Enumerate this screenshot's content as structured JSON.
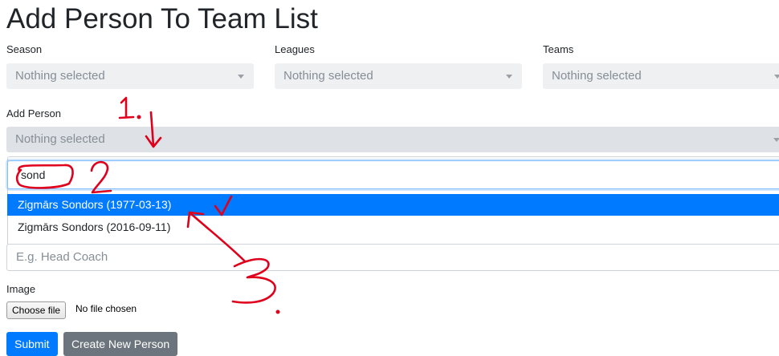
{
  "page": {
    "title": "Add Person To Team List"
  },
  "filters": [
    {
      "label": "Season",
      "placeholder": "Nothing selected"
    },
    {
      "label": "Leagues",
      "placeholder": "Nothing selected"
    },
    {
      "label": "Teams",
      "placeholder": "Nothing selected"
    }
  ],
  "add_person": {
    "label": "Add Person",
    "placeholder": "Nothing selected",
    "search_value": "sond",
    "options": [
      {
        "label": "Zigmārs Sondors (1977-03-13)",
        "active": true
      },
      {
        "label": "Zigmārs Sondors (2016-09-11)",
        "active": false
      }
    ]
  },
  "role_input": {
    "placeholder": "E.g. Head Coach"
  },
  "image": {
    "label": "Image",
    "choose_button": "Choose file",
    "status": "No file chosen"
  },
  "buttons": {
    "submit": "Submit",
    "create_person": "Create New Person"
  },
  "annotations": {
    "step1": "1.",
    "step2": "2",
    "step3": "3",
    "color": "#e0001b"
  },
  "colors": {
    "primary": "#007bff",
    "secondary": "#6c757d"
  }
}
